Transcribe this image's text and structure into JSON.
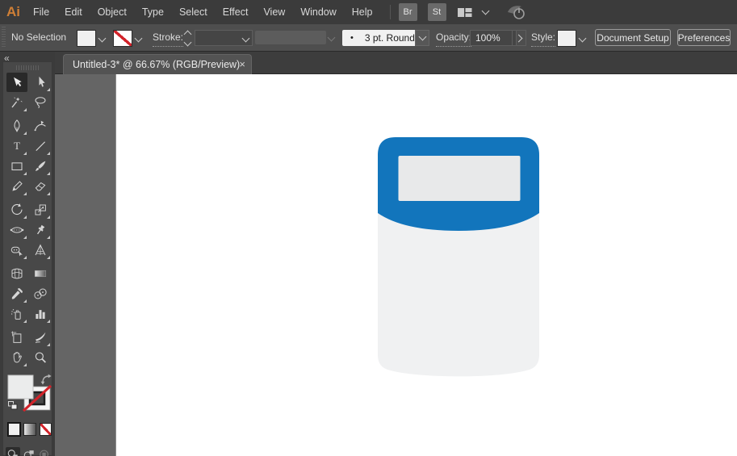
{
  "menubar": {
    "logo_text": "Ai",
    "items": [
      "File",
      "Edit",
      "Object",
      "Type",
      "Select",
      "Effect",
      "View",
      "Window",
      "Help"
    ],
    "bridge_label": "Br",
    "stock_label": "St",
    "icon_names": [
      "bridge-button",
      "stock-button",
      "workspace-switcher-icon",
      "chevron-down-icon",
      "sync-power-icon"
    ]
  },
  "controlbar": {
    "selection_status": "No Selection",
    "stroke_label": "Stroke:",
    "brush_preview_dot": "•",
    "brush_name": "3 pt. Round",
    "opacity_label": "Opacity:",
    "opacity_value": "100%",
    "style_label": "Style:",
    "document_setup_label": "Document Setup",
    "preferences_label": "Preferences"
  },
  "document_tab": {
    "title": "Untitled-3* @ 66.67% (RGB/Preview)",
    "close_glyph": "×"
  },
  "toolbar": {
    "collapse_glyph": "«",
    "group_breaks_after": [
      2,
      6,
      9,
      12
    ],
    "tools": [
      {
        "name": "selection-tool",
        "icon": "selection-arrow",
        "active": true,
        "flyout": false
      },
      {
        "name": "direct-selection-tool",
        "icon": "direct-selection-arrow",
        "active": false,
        "flyout": true
      },
      {
        "name": "magic-wand-tool",
        "icon": "magic-wand",
        "active": false,
        "flyout": true
      },
      {
        "name": "lasso-tool",
        "icon": "lasso",
        "active": false,
        "flyout": false
      },
      {
        "name": "pen-tool",
        "icon": "pen",
        "active": false,
        "flyout": true
      },
      {
        "name": "curvature-tool",
        "icon": "curvature",
        "active": false,
        "flyout": false
      },
      {
        "name": "type-tool",
        "icon": "type",
        "active": false,
        "flyout": true
      },
      {
        "name": "line-segment-tool",
        "icon": "line",
        "active": false,
        "flyout": true
      },
      {
        "name": "rectangle-tool",
        "icon": "rectangle",
        "active": false,
        "flyout": true
      },
      {
        "name": "paintbrush-tool",
        "icon": "paintbrush",
        "active": false,
        "flyout": true
      },
      {
        "name": "shaper-tool",
        "icon": "shaper",
        "active": false,
        "flyout": true
      },
      {
        "name": "eraser-tool",
        "icon": "eraser",
        "active": false,
        "flyout": true
      },
      {
        "name": "rotate-tool",
        "icon": "rotate",
        "active": false,
        "flyout": true
      },
      {
        "name": "scale-tool",
        "icon": "scale",
        "active": false,
        "flyout": true
      },
      {
        "name": "width-tool",
        "icon": "width",
        "active": false,
        "flyout": true
      },
      {
        "name": "puppet-warp-tool",
        "icon": "puppet-warp",
        "active": false,
        "flyout": true
      },
      {
        "name": "shape-builder-tool",
        "icon": "shape-builder",
        "active": false,
        "flyout": true
      },
      {
        "name": "perspective-grid-tool",
        "icon": "perspective-grid",
        "active": false,
        "flyout": true
      },
      {
        "name": "mesh-tool",
        "icon": "mesh",
        "active": false,
        "flyout": false
      },
      {
        "name": "gradient-tool",
        "icon": "gradient",
        "active": false,
        "flyout": false
      },
      {
        "name": "eyedropper-tool",
        "icon": "eyedropper",
        "active": false,
        "flyout": true
      },
      {
        "name": "blend-tool",
        "icon": "blend",
        "active": false,
        "flyout": false
      },
      {
        "name": "symbol-sprayer-tool",
        "icon": "symbol-sprayer",
        "active": false,
        "flyout": true
      },
      {
        "name": "column-graph-tool",
        "icon": "column-graph",
        "active": false,
        "flyout": true
      },
      {
        "name": "artboard-tool",
        "icon": "artboard",
        "active": false,
        "flyout": false
      },
      {
        "name": "slice-tool",
        "icon": "slice",
        "active": false,
        "flyout": true
      },
      {
        "name": "hand-tool",
        "icon": "hand",
        "active": false,
        "flyout": true
      },
      {
        "name": "zoom-tool",
        "icon": "zoom",
        "active": false,
        "flyout": false
      }
    ],
    "bottom_icon_names": [
      "fill-swatch",
      "stroke-swatch",
      "swap-fill-stroke-icon",
      "default-fill-stroke-icon",
      "color-button",
      "gradient-button",
      "none-button",
      "draw-normal-button",
      "draw-behind-button",
      "draw-inside-button"
    ]
  },
  "artwork": {
    "description": "Rounded container icon: blue cap with light gray screen and light gray cylindrical body",
    "cap_color": "#1275bc",
    "screen_color": "#e8e9ea",
    "body_color": "#f0f1f2"
  },
  "colors": {
    "menubar_bg": "#3b3b3b",
    "controlbar_bg": "#4e4e4e",
    "toolbar_bg": "#484848",
    "pasteboard": "#656565",
    "artboard": "#ffffff",
    "tab_active_bg": "#535353",
    "none_red": "#d2232a",
    "logo_orange": "#cf7f36"
  }
}
